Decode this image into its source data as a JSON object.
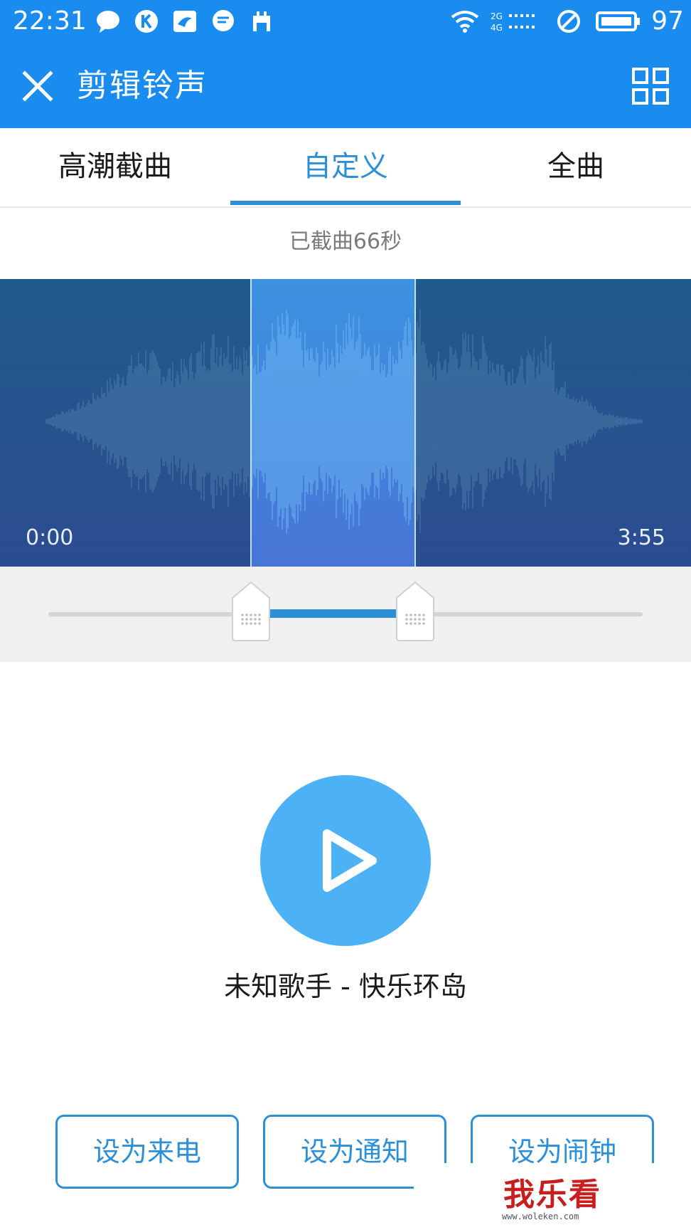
{
  "status_bar": {
    "time": "22:31",
    "battery_level": "97",
    "icons": [
      "chat-bubble-icon",
      "k-app-icon",
      "bird-app-icon",
      "message-icon",
      "calendar-icon",
      "wifi-icon",
      "signal-2g-4g-icon",
      "do-not-disturb-icon",
      "battery-icon"
    ]
  },
  "header": {
    "title": "剪辑铃声",
    "close_icon": "close-icon",
    "menu_icon": "grid-icon"
  },
  "tabs": [
    {
      "label": "高潮截曲",
      "active": false
    },
    {
      "label": "自定义",
      "active": true
    },
    {
      "label": "全曲",
      "active": false
    }
  ],
  "clip_info": "已截曲66秒",
  "waveform": {
    "start_time": "0:00",
    "end_time": "3:55"
  },
  "player": {
    "play_icon": "play-icon",
    "song_title": "未知歌手 - 快乐环岛"
  },
  "actions": {
    "ringtone": "设为来电",
    "notification": "设为通知",
    "alarm": "设为闹钟"
  },
  "watermark": {
    "text": "我乐看",
    "url": "www.woleken.com"
  },
  "colors": {
    "primary": "#1a8cf0",
    "accent": "#2d8fd5",
    "play_button": "#4cb1f5",
    "waveform_bg": "#2c4c90"
  }
}
